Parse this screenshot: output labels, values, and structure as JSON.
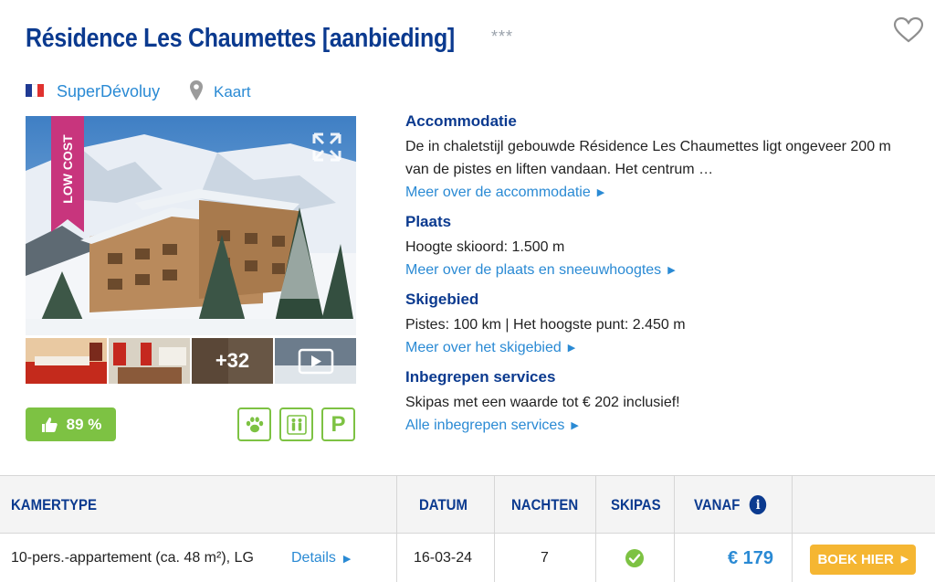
{
  "header": {
    "title": "Résidence Les Chaumettes [aanbieding]",
    "stars": "***",
    "region": "SuperDévoluy",
    "map_link": "Kaart"
  },
  "gallery": {
    "badge": "LOW COST",
    "more_photos": "+32"
  },
  "rating": {
    "value": "89 %"
  },
  "amenities": [
    {
      "icon": "paw-icon"
    },
    {
      "icon": "family-icon"
    },
    {
      "icon": "parking-icon",
      "label": "P"
    }
  ],
  "info": {
    "accommodation": {
      "heading": "Accommodatie",
      "text": "De in chaletstijl gebouwde Résidence Les Chaumettes ligt ongeveer 200 m van de pistes en liften vandaan. Het centrum …",
      "link": "Meer over de accommodatie"
    },
    "place": {
      "heading": "Plaats",
      "text": "Hoogte skioord: 1.500 m",
      "link": "Meer over de plaats en sneeuwhoogtes"
    },
    "ski_area": {
      "heading": "Skigebied",
      "text": "Pistes: 100 km | Het hoogste punt: 2.450 m",
      "link": "Meer over het skigebied"
    },
    "services": {
      "heading": "Inbegrepen services",
      "text": "Skipas met een waarde tot € 202 inclusief!",
      "link": "Alle inbegrepen services"
    }
  },
  "table": {
    "headers": {
      "room_type": "KAMERTYPE",
      "date": "DATUM",
      "nights": "NACHTEN",
      "skipass": "SKIPAS",
      "from": "VANAF"
    },
    "row": {
      "room_type": "10-pers.-appartement (ca. 48 m²), LG",
      "details": "Details",
      "date": "16-03-24",
      "nights": "7",
      "price": "€ 179",
      "book": "BOEK HIER"
    }
  },
  "colors": {
    "title_blue": "#0b3a8f",
    "link_blue": "#2a8ad4",
    "green": "#7dc243",
    "orange": "#f5b632",
    "badge_pink": "#c8357d"
  }
}
